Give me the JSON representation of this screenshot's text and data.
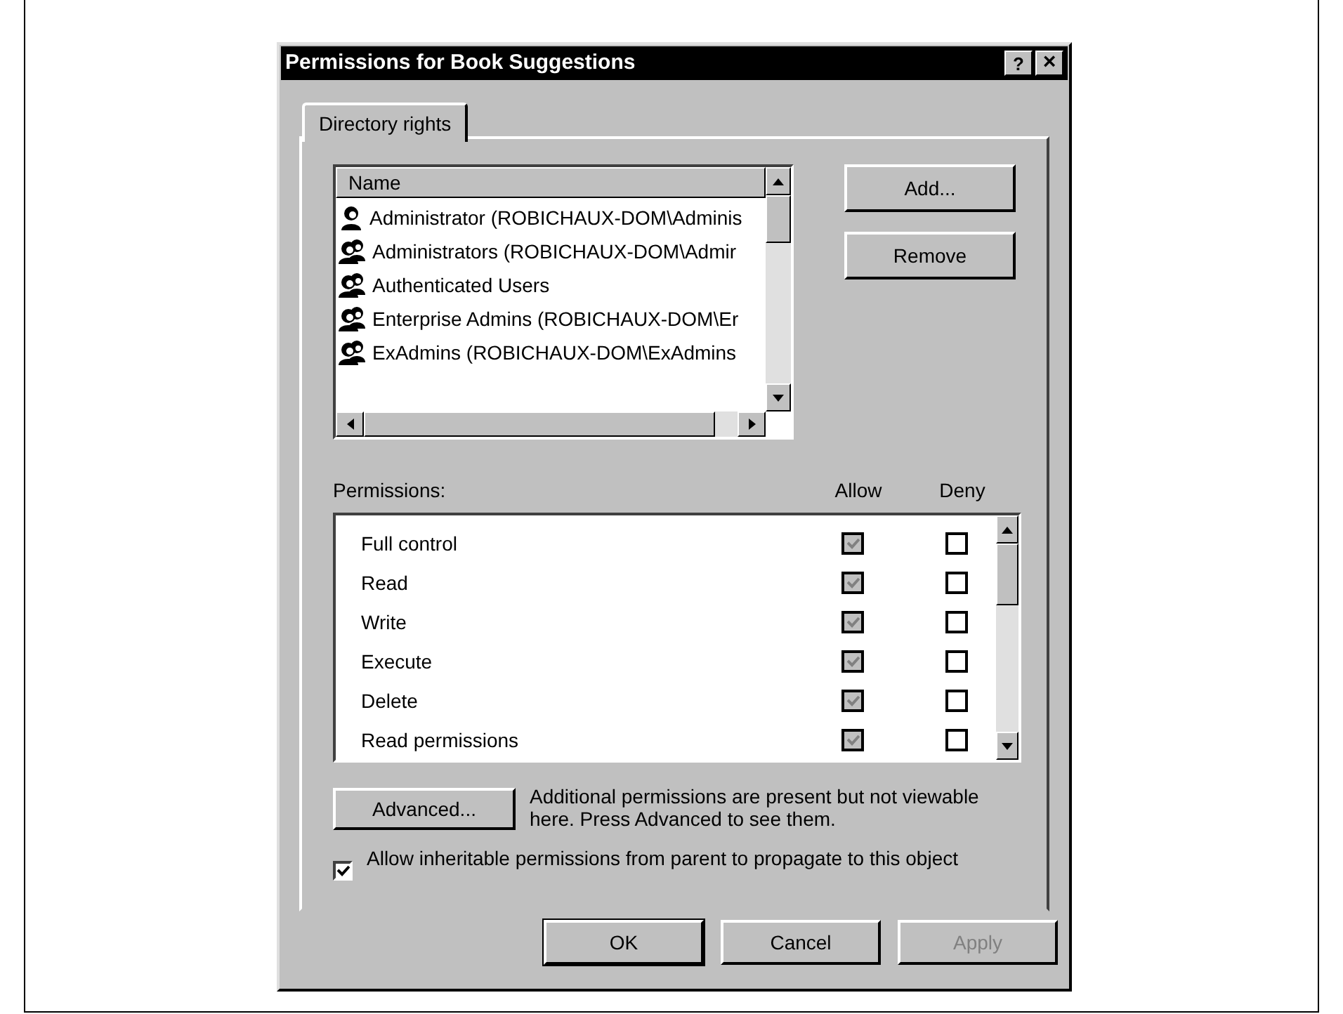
{
  "window": {
    "title": "Permissions for Book Suggestions",
    "help_button": "?",
    "close_button": "×"
  },
  "tabs": [
    {
      "label": "Directory rights",
      "selected": true
    }
  ],
  "names_list": {
    "column": "Name",
    "items": [
      {
        "kind": "user",
        "label": "Administrator (ROBICHAUX-DOM\\Adminis"
      },
      {
        "kind": "group",
        "label": "Administrators (ROBICHAUX-DOM\\Admir"
      },
      {
        "kind": "group",
        "label": "Authenticated Users"
      },
      {
        "kind": "group",
        "label": "Enterprise Admins (ROBICHAUX-DOM\\Er"
      },
      {
        "kind": "group",
        "label": "ExAdmins (ROBICHAUX-DOM\\ExAdmins"
      }
    ]
  },
  "side_buttons": [
    "Add...",
    "Remove"
  ],
  "permissions": {
    "label": "Permissions:",
    "allow_header": "Allow",
    "deny_header": "Deny",
    "rows": [
      {
        "name": "Full control",
        "allow": {
          "checked": true,
          "disabled": true
        },
        "deny": {
          "checked": false,
          "disabled": false
        }
      },
      {
        "name": "Read",
        "allow": {
          "checked": true,
          "disabled": true
        },
        "deny": {
          "checked": false,
          "disabled": false
        }
      },
      {
        "name": "Write",
        "allow": {
          "checked": true,
          "disabled": true
        },
        "deny": {
          "checked": false,
          "disabled": false
        }
      },
      {
        "name": "Execute",
        "allow": {
          "checked": true,
          "disabled": true
        },
        "deny": {
          "checked": false,
          "disabled": false
        }
      },
      {
        "name": "Delete",
        "allow": {
          "checked": true,
          "disabled": true
        },
        "deny": {
          "checked": false,
          "disabled": false
        }
      },
      {
        "name": "Read permissions",
        "allow": {
          "checked": true,
          "disabled": true
        },
        "deny": {
          "checked": false,
          "disabled": false
        }
      }
    ]
  },
  "advanced": {
    "button": "Advanced...",
    "note": "Additional permissions are present but not viewable here. Press Advanced to see them."
  },
  "inherit": {
    "label": "Allow inheritable permissions from parent to propagate to this object",
    "checked": true
  },
  "buttons": [
    {
      "label": "OK",
      "default": true,
      "disabled": false
    },
    {
      "label": "Cancel",
      "default": false,
      "disabled": false
    },
    {
      "label": "Apply",
      "default": false,
      "disabled": true
    }
  ]
}
